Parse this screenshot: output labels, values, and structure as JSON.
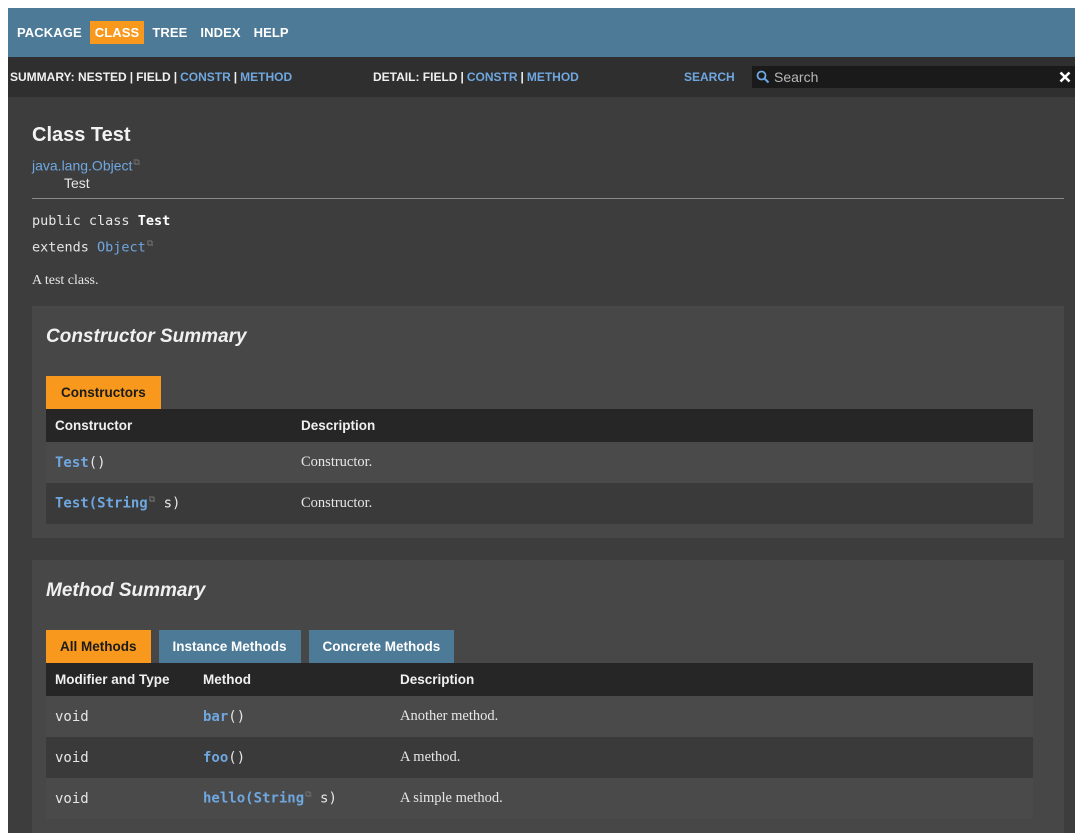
{
  "nav": {
    "items": [
      "PACKAGE",
      "CLASS",
      "TREE",
      "INDEX",
      "HELP"
    ],
    "active": "CLASS"
  },
  "subnav": {
    "summary_label": "SUMMARY:",
    "summary_nested": "NESTED",
    "summary_field": "FIELD",
    "summary_constr": "CONSTR",
    "summary_method": "METHOD",
    "detail_label": "DETAIL:",
    "detail_field": "FIELD",
    "detail_constr": "CONSTR",
    "detail_method": "METHOD",
    "search_label": "SEARCH",
    "search_placeholder": "Search",
    "separator": "|"
  },
  "page": {
    "title": "Class Test",
    "parent_class": "java.lang.Object",
    "child_class": "Test",
    "signature_keyword": "public class",
    "signature_name": "Test",
    "extends_keyword": "extends",
    "extends_type": "Object",
    "description": "A test class."
  },
  "constructors": {
    "heading": "Constructor Summary",
    "tab": "Constructors",
    "columns": [
      "Constructor",
      "Description"
    ],
    "rows": [
      {
        "name": "Test",
        "params_open": "(",
        "param_type": "",
        "param_name": "",
        "params_close": ")",
        "description": "Constructor."
      },
      {
        "name": "Test",
        "params_open": "(",
        "param_type": "String",
        "param_name": " s",
        "params_close": ")",
        "description": "Constructor."
      }
    ]
  },
  "methods": {
    "heading": "Method Summary",
    "tabs": [
      "All Methods",
      "Instance Methods",
      "Concrete Methods"
    ],
    "active_tab": "All Methods",
    "columns": [
      "Modifier and Type",
      "Method",
      "Description"
    ],
    "rows": [
      {
        "type": "void",
        "name": "bar",
        "param_type": "",
        "param_name": "",
        "description": "Another method."
      },
      {
        "type": "void",
        "name": "foo",
        "param_type": "",
        "param_name": "",
        "description": "A method."
      },
      {
        "type": "void",
        "name": "hello",
        "param_type": "String",
        "param_name": " s",
        "description": "A simple method."
      }
    ]
  },
  "colors": {
    "nav_bg": "#4d7a97",
    "accent": "#f8981d",
    "link": "#6fa7e0",
    "page_bg": "#3d3d3d"
  },
  "icons": {
    "search": "magnifier-icon",
    "reset": "close-icon",
    "external": "external-link-icon"
  }
}
